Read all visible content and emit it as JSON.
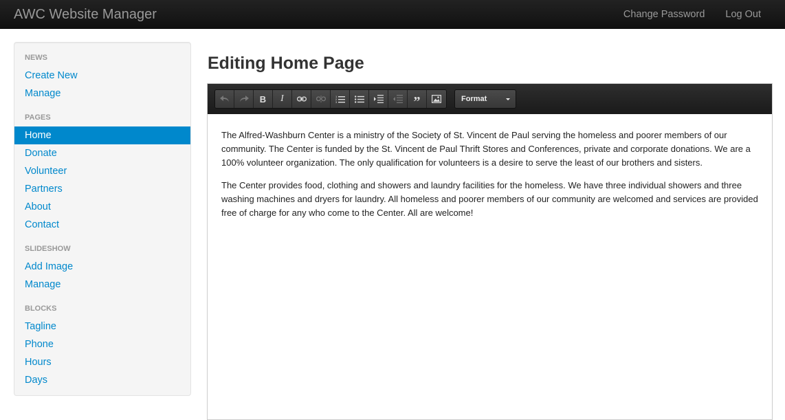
{
  "navbar": {
    "brand": "AWC Website Manager",
    "links": [
      "Change Password",
      "Log Out"
    ]
  },
  "sidebar": {
    "news": {
      "header": "NEWS",
      "items": [
        "Create New",
        "Manage"
      ]
    },
    "pages": {
      "header": "PAGES",
      "items": [
        "Home",
        "Donate",
        "Volunteer",
        "Partners",
        "About",
        "Contact"
      ],
      "active": "Home"
    },
    "slideshow": {
      "header": "SLIDESHOW",
      "items": [
        "Add Image",
        "Manage"
      ]
    },
    "blocks": {
      "header": "BLOCKS",
      "items": [
        "Tagline",
        "Phone",
        "Hours",
        "Days"
      ]
    }
  },
  "main": {
    "title": "Editing Home Page",
    "toolbar": {
      "bold": "B",
      "italic": "I",
      "blockquote": "”",
      "format_label": "Format",
      "icons": [
        "undo-icon",
        "redo-icon",
        "bold-icon",
        "italic-icon",
        "link-icon",
        "unlink-icon",
        "ordered-list-icon",
        "unordered-list-icon",
        "indent-icon",
        "outdent-icon",
        "blockquote-icon",
        "image-icon"
      ]
    },
    "content": {
      "paragraphs": [
        "The Alfred-Washburn Center is a ministry of the Society of St. Vincent de Paul serving the homeless and poorer members of our community. The Center is funded by the St. Vincent de Paul Thrift Stores and Conferences, private and corporate donations. We are a 100% volunteer organization. The only qualification for volunteers is a desire to serve the least of our brothers and sisters.",
        "The Center provides food, clothing and showers and laundry facilities for the homeless. We have three individual showers and three washing machines and dryers for laundry. All homeless and poorer members of our community are welcomed and services are provided free of charge for any who come to the Center. All are welcome!"
      ]
    }
  },
  "colors": {
    "accent": "#0088cc",
    "navbar": "#1b1b1b",
    "toolbar": "#222222"
  }
}
